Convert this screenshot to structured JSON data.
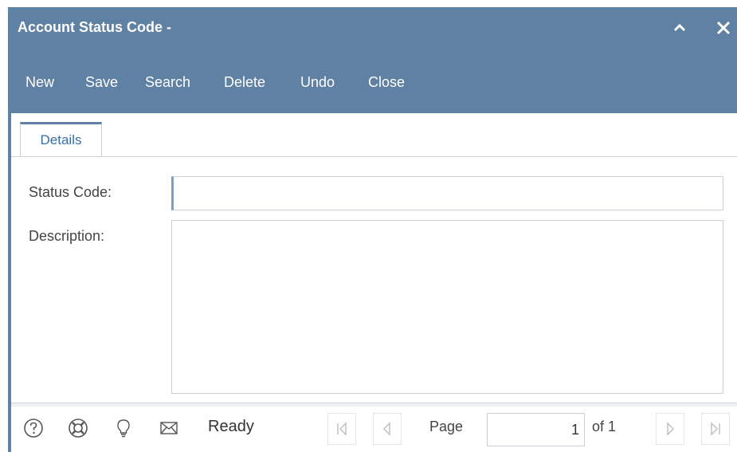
{
  "window": {
    "title": "Account Status Code -",
    "minimize_glyph": "^",
    "close_glyph": "✕"
  },
  "toolbar": {
    "items": [
      "New",
      "Save",
      "Search",
      "Delete",
      "Undo",
      "Close"
    ]
  },
  "tabs": [
    {
      "label": "Details",
      "active": true
    }
  ],
  "form": {
    "status_code_label": "Status Code:",
    "status_code_value": "",
    "description_label": "Description:",
    "description_value": ""
  },
  "statusbar": {
    "icons": [
      "help-icon",
      "support-icon",
      "lightbulb-icon",
      "mail-icon"
    ],
    "status": "Ready",
    "page_label": "Page",
    "page_value": "1",
    "of_label": "of 1"
  },
  "colors": {
    "accent": "#5e81a4",
    "tab_text": "#3a6ea5"
  }
}
